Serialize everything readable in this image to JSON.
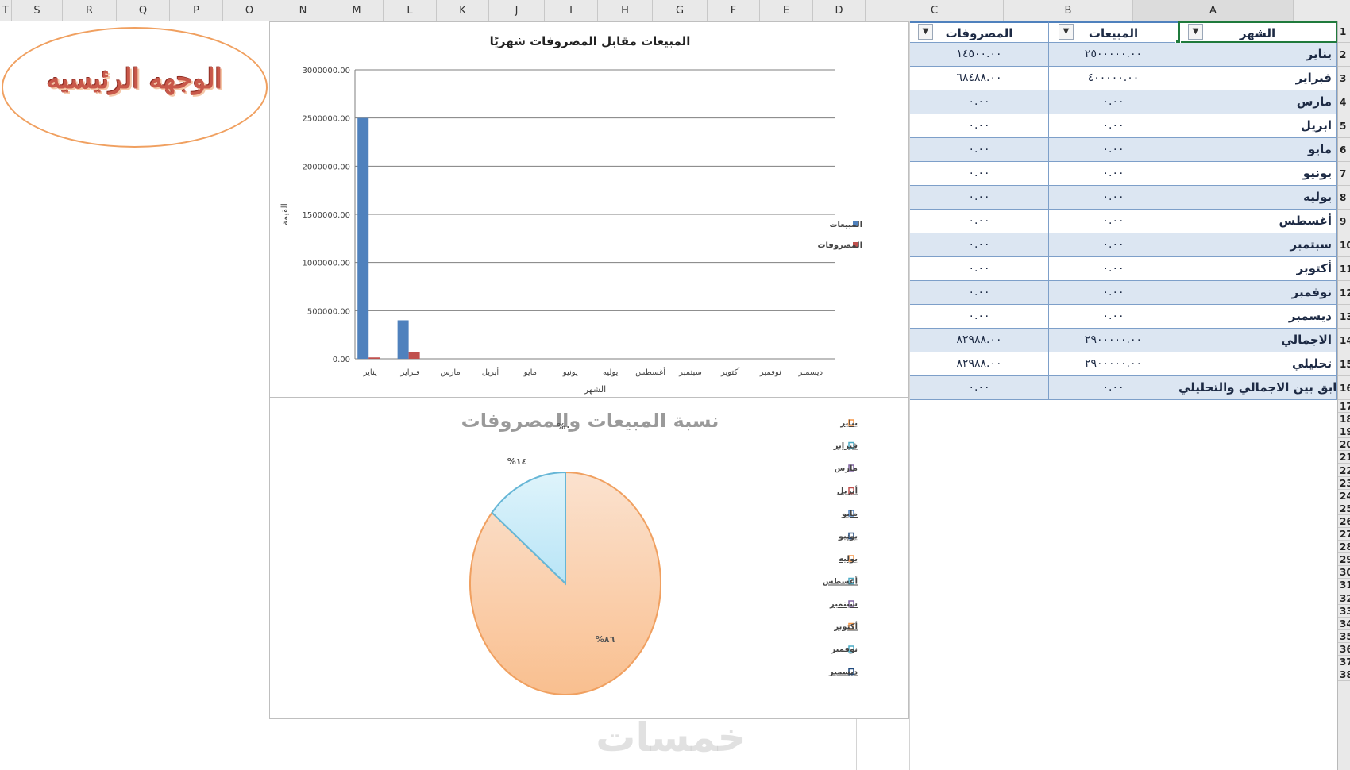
{
  "sheet": {
    "columns": [
      "T",
      "S",
      "R",
      "Q",
      "P",
      "O",
      "N",
      "M",
      "L",
      "K",
      "J",
      "I",
      "H",
      "G",
      "F",
      "E",
      "D",
      "C",
      "B",
      "A"
    ],
    "active_column": "A",
    "row_numbers": [
      "1",
      "2",
      "3",
      "4",
      "5",
      "6",
      "7",
      "8",
      "9",
      "10",
      "11",
      "12",
      "13",
      "14",
      "15",
      "16",
      "17",
      "18",
      "19",
      "20",
      "21",
      "22",
      "23",
      "24",
      "25",
      "26",
      "27",
      "28",
      "29",
      "30",
      "31",
      "32",
      "33",
      "34",
      "35",
      "36",
      "37",
      "38"
    ]
  },
  "home_button": {
    "label": "الوجهه الرئيسيه"
  },
  "table": {
    "headers": {
      "month": "الشهر",
      "sales": "المبيعات",
      "expenses": "المصروفات"
    },
    "filter_glyph": "▼",
    "rows": [
      {
        "month": "يناير",
        "sales": "٢٥٠٠٠٠٠.٠٠",
        "expenses": "١٤٥٠٠.٠٠"
      },
      {
        "month": "فبراير",
        "sales": "٤٠٠٠٠٠.٠٠",
        "expenses": "٦٨٤٨٨.٠٠"
      },
      {
        "month": "مارس",
        "sales": "٠.٠٠",
        "expenses": "٠.٠٠"
      },
      {
        "month": "ابريل",
        "sales": "٠.٠٠",
        "expenses": "٠.٠٠"
      },
      {
        "month": "مايو",
        "sales": "٠.٠٠",
        "expenses": "٠.٠٠"
      },
      {
        "month": "يونيو",
        "sales": "٠.٠٠",
        "expenses": "٠.٠٠"
      },
      {
        "month": "يوليه",
        "sales": "٠.٠٠",
        "expenses": "٠.٠٠"
      },
      {
        "month": "أغسطس",
        "sales": "٠.٠٠",
        "expenses": "٠.٠٠"
      },
      {
        "month": "سبتمبر",
        "sales": "٠.٠٠",
        "expenses": "٠.٠٠"
      },
      {
        "month": "أكتوبر",
        "sales": "٠.٠٠",
        "expenses": "٠.٠٠"
      },
      {
        "month": "نوفمبر",
        "sales": "٠.٠٠",
        "expenses": "٠.٠٠"
      },
      {
        "month": "ديسمبر",
        "sales": "٠.٠٠",
        "expenses": "٠.٠٠"
      },
      {
        "month": "الاجمالي",
        "sales": "٢٩٠٠٠٠٠.٠٠",
        "expenses": "٨٢٩٨٨.٠٠"
      },
      {
        "month": "تحليلي",
        "sales": "٢٩٠٠٠٠٠.٠٠",
        "expenses": "٨٢٩٨٨.٠٠"
      },
      {
        "month": "مطابق بين الاجمالي والتحليلي",
        "sales": "٠.٠٠",
        "expenses": "٠.٠٠"
      }
    ]
  },
  "chart_data": [
    {
      "type": "bar",
      "title": "المبيعات مقابل المصروفات شهريًا",
      "xlabel": "الشهر",
      "ylabel": "القيمة",
      "categories": [
        "يناير",
        "فبراير",
        "مارس",
        "أبريل",
        "مايو",
        "يونيو",
        "يوليه",
        "أغسطس",
        "سبتمبر",
        "أكتوبر",
        "نوفمبر",
        "ديسمبر"
      ],
      "series": [
        {
          "name": "المبيعات",
          "color": "#4f81bd",
          "values": [
            2500000,
            400000,
            0,
            0,
            0,
            0,
            0,
            0,
            0,
            0,
            0,
            0
          ]
        },
        {
          "name": "المصروفات",
          "color": "#c0504d",
          "values": [
            14500,
            68488,
            0,
            0,
            0,
            0,
            0,
            0,
            0,
            0,
            0,
            0
          ]
        }
      ],
      "ylim": [
        0,
        3000000
      ],
      "yticks": [
        "0.00",
        "500000.00",
        "1000000.00",
        "1500000.00",
        "2000000.00",
        "2500000.00",
        "3000000.00"
      ],
      "grid": true,
      "legend": "right"
    },
    {
      "type": "pie",
      "title": "نسبة المبيعات والمصروفات",
      "labels": [
        "يناير",
        "فبراير",
        "مارس",
        "أبريل",
        "مايو",
        "يونيو",
        "يوليه",
        "أغسطس",
        "سبتمبر",
        "أكتوبر",
        "نوفمبر",
        "ديسمبر"
      ],
      "values": [
        86,
        14,
        0,
        0,
        0,
        0,
        0,
        0,
        0,
        0,
        0,
        0
      ],
      "data_labels": [
        "%٨٦",
        "%١٤",
        "%٠"
      ],
      "legend_colors": [
        "#f79646",
        "#4bacc6",
        "#8064a2",
        "#c0504d",
        "#4f81bd",
        "#1f497d",
        "#f79646",
        "#4bacc6",
        "#8064a2",
        "#f79646",
        "#4bacc6",
        "#1f497d"
      ],
      "legend": "right"
    }
  ],
  "watermark": "خمسات"
}
